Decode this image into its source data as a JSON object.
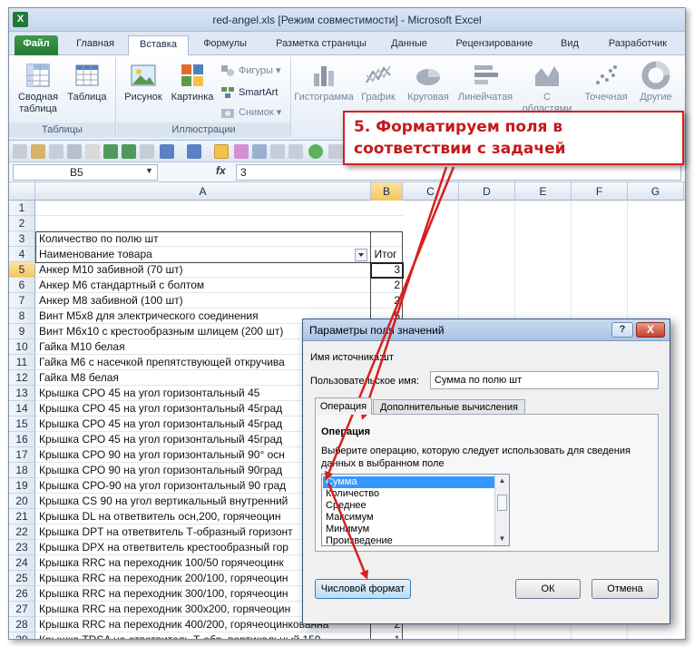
{
  "window": {
    "title": "red-angel.xls  [Режим совместимости] - Microsoft Excel"
  },
  "ribbon_tabs": [
    {
      "label": "Файл"
    },
    {
      "label": "Главная"
    },
    {
      "label": "Вставка"
    },
    {
      "label": "Формулы"
    },
    {
      "label": "Разметка страницы"
    },
    {
      "label": "Данные"
    },
    {
      "label": "Рецензирование"
    },
    {
      "label": "Вид"
    },
    {
      "label": "Разработчик"
    }
  ],
  "ribbon_groups": {
    "tables": {
      "label": "Таблицы",
      "pivot_label_1": "Сводная",
      "pivot_label_2": "таблица",
      "table_label": "Таблица"
    },
    "illustrations": {
      "label": "Иллюстрации",
      "picture_label": "Рисунок",
      "clipart_label": "Картинка",
      "shapes_label": "Фигуры",
      "smartart_label": "SmartArt",
      "screenshot_label": "Снимок"
    },
    "charts": {
      "histogram_label": "Гистограмма",
      "line_label": "График",
      "pie_label": "Круговая",
      "bar_label": "Линейчатая",
      "area_label_1": "С",
      "area_label_2": "областями",
      "scatter_label": "Точечная",
      "other_label": "Другие"
    }
  },
  "formula_bar": {
    "name_box": "B5",
    "fx_label": "fx",
    "value": "3"
  },
  "columns": [
    "A",
    "B",
    "C",
    "D",
    "E",
    "F",
    "G"
  ],
  "rows": [
    {
      "num": "1",
      "a": "",
      "b": ""
    },
    {
      "num": "2",
      "a": "",
      "b": ""
    },
    {
      "num": "3",
      "a": "Количество по полю шт",
      "b": ""
    },
    {
      "num": "4",
      "a": "Наименование товара",
      "b": "Итог"
    },
    {
      "num": "5",
      "a": "Анкер М10 забивной (70 шт)",
      "b": "3"
    },
    {
      "num": "6",
      "a": "Анкер М6 стандартный с болтом",
      "b": "2"
    },
    {
      "num": "7",
      "a": "Анкер М8 забивной (100 шт)",
      "b": "2"
    },
    {
      "num": "8",
      "a": "Винт М5х8 для электрического соединения",
      "b": "5"
    },
    {
      "num": "9",
      "a": "Винт М6х10 с крестообразным шлицем (200 шт)",
      "b": "2"
    },
    {
      "num": "10",
      "a": "Гайка М10 белая",
      "b": ""
    },
    {
      "num": "11",
      "a": "Гайка М6 с насечкой препятствующей откручива",
      "b": ""
    },
    {
      "num": "12",
      "a": "Гайка М8 белая",
      "b": ""
    },
    {
      "num": "13",
      "a": "Крышка СРО 45 на  угол горизонтальный 45",
      "b": ""
    },
    {
      "num": "14",
      "a": "Крышка СРО 45 на угол горизонтальный 45град",
      "b": ""
    },
    {
      "num": "15",
      "a": "Крышка СРО 45 на угол горизонтальный 45град",
      "b": ""
    },
    {
      "num": "16",
      "a": "Крышка СРО 45 на угол горизонтальный 45град",
      "b": ""
    },
    {
      "num": "17",
      "a": "Крышка СРО 90 на угол горизонтальный 90°  осн",
      "b": ""
    },
    {
      "num": "18",
      "a": "Крышка СРО 90 на угол горизонтальный 90град",
      "b": ""
    },
    {
      "num": "19",
      "a": "Крышка СРО-90 на угол горизонтальный 90 град",
      "b": ""
    },
    {
      "num": "20",
      "a": "Крышка CS 90 на угол вертикальный внутренний",
      "b": ""
    },
    {
      "num": "21",
      "a": "Крышка DL на ответвитель осн,200, горячеоцин",
      "b": ""
    },
    {
      "num": "22",
      "a": "Крышка DPT на ответвитель Т-образный горизонт",
      "b": ""
    },
    {
      "num": "23",
      "a": "Крышка DPX на ответвитель крестообразный гор",
      "b": ""
    },
    {
      "num": "24",
      "a": "Крышка RRC на переходник 100/50 горячеоцинк",
      "b": ""
    },
    {
      "num": "25",
      "a": "Крышка RRC на переходник 200/100, горячеоцин",
      "b": ""
    },
    {
      "num": "26",
      "a": "Крышка RRC на переходник 300/100, горячеоцин",
      "b": ""
    },
    {
      "num": "27",
      "a": "Крышка RRC на переходник 300х200, горячеоцин",
      "b": ""
    },
    {
      "num": "28",
      "a": "Крышка RRC на переходник 400/200, горячеоцинкованна",
      "b": "2"
    },
    {
      "num": "29",
      "a": "Крышка TDSA на ответвитель Т-обр. вертикальный 150",
      "b": "1"
    }
  ],
  "dialog": {
    "title": "Параметры поля значений",
    "help": "?",
    "close": "X",
    "source_label": "Имя источника:",
    "source_value": "шт",
    "custom_name_label": "Пользовательское имя:",
    "custom_name_value": "Сумма по полю шт",
    "tab_operation": "Операция",
    "tab_additional": "Дополнительные вычисления",
    "section_title": "Операция",
    "description": "Выберите операцию, которую следует использовать для сведения данных в выбранном поле",
    "operations": [
      "Сумма",
      "Количество",
      "Среднее",
      "Максимум",
      "Минимум",
      "Произведение"
    ],
    "number_format_button": "Числовой формат",
    "ok_button": "ОК",
    "cancel_button": "Отмена"
  },
  "callout": {
    "line1": "5. Форматируем поля в",
    "line2": "соответствии с задачей"
  },
  "colors": {
    "accent_red": "#d52020",
    "selection_blue": "#3399ff",
    "file_tab_green": "#237a33"
  }
}
